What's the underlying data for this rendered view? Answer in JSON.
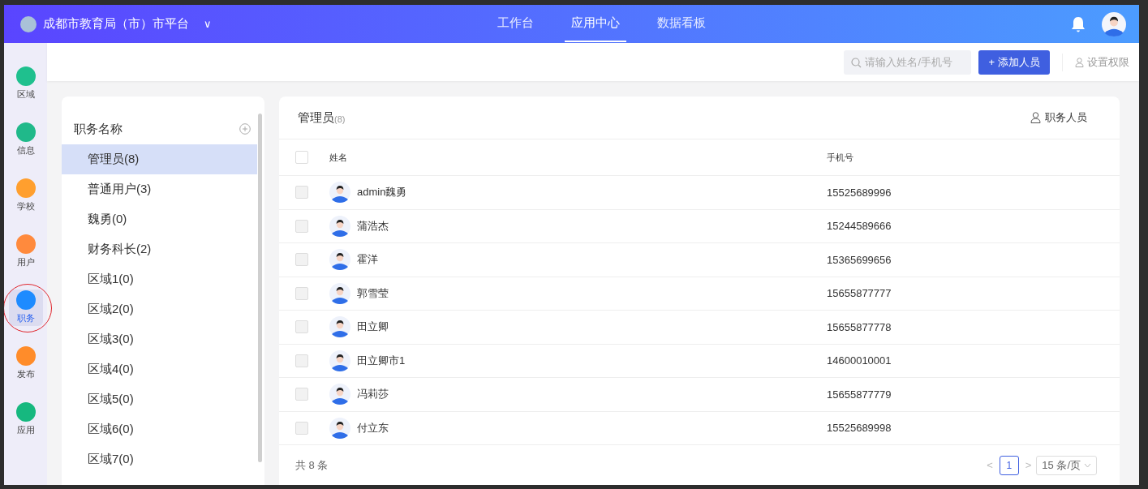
{
  "topbar": {
    "brand": "成都市教育局（市）市平台",
    "caret": "∨",
    "nav": [
      {
        "label": "工作台",
        "selected": false
      },
      {
        "label": "应用中心",
        "selected": true
      },
      {
        "label": "数据看板",
        "selected": false
      }
    ]
  },
  "toolbar": {
    "search": {
      "placeholder": "请输入姓名/手机号"
    },
    "add_button": {
      "icon": "+",
      "label": "添加人员"
    },
    "settings_link": "设置权限"
  },
  "sidebar": {
    "items": [
      {
        "label": "区域",
        "color": "#1fc08e",
        "selected": false,
        "circled": false
      },
      {
        "label": "信息",
        "color": "#20b98a",
        "selected": false,
        "circled": false
      },
      {
        "label": "学校",
        "color": "#ff9f2e",
        "selected": false,
        "circled": false
      },
      {
        "label": "用户",
        "color": "#ff8a3d",
        "selected": false,
        "circled": false
      },
      {
        "label": "职务",
        "color": "#1e8bff",
        "selected": true,
        "circled": true
      },
      {
        "label": "发布",
        "color": "#ff8c2a",
        "selected": false,
        "circled": false
      },
      {
        "label": "应用",
        "color": "#16b87f",
        "selected": false,
        "circled": false
      }
    ]
  },
  "roles_panel": {
    "heading": "职务名称",
    "items": [
      {
        "label": "管理员(8)",
        "selected": true
      },
      {
        "label": "普通用户(3)",
        "selected": false
      },
      {
        "label": "魏勇(0)",
        "selected": false
      },
      {
        "label": "财务科长(2)",
        "selected": false
      },
      {
        "label": "区域1(0)",
        "selected": false
      },
      {
        "label": "区域2(0)",
        "selected": false
      },
      {
        "label": "区域3(0)",
        "selected": false
      },
      {
        "label": "区域4(0)",
        "selected": false
      },
      {
        "label": "区域5(0)",
        "selected": false
      },
      {
        "label": "区域6(0)",
        "selected": false
      },
      {
        "label": "区域7(0)",
        "selected": false
      }
    ]
  },
  "members_panel": {
    "title": "管理员",
    "count": "(8)",
    "action": "职务人员",
    "columns": [
      "姓名",
      "手机号"
    ],
    "select_all": {
      "checked": false
    },
    "rows": [
      {
        "name": "admin魏勇",
        "phone": "15525689996",
        "checked": false
      },
      {
        "name": "蒲浩杰",
        "phone": "15244589666",
        "checked": false
      },
      {
        "name": "霍洋",
        "phone": "15365699656",
        "checked": false
      },
      {
        "name": "郭雪莹",
        "phone": "15655877777",
        "checked": false
      },
      {
        "name": "田立卿",
        "phone": "15655877778",
        "checked": false
      },
      {
        "name": "田立卿市1",
        "phone": "14600010001",
        "checked": false
      },
      {
        "name": "冯莉莎",
        "phone": "15655877779",
        "checked": false
      },
      {
        "name": "付立东",
        "phone": "15525689998",
        "checked": false
      }
    ],
    "footer": {
      "total": "共 8 条",
      "prev": "<",
      "pages": [
        {
          "label": "1",
          "selected": true
        }
      ],
      "next": ">",
      "page_size": "15 条/页"
    }
  }
}
